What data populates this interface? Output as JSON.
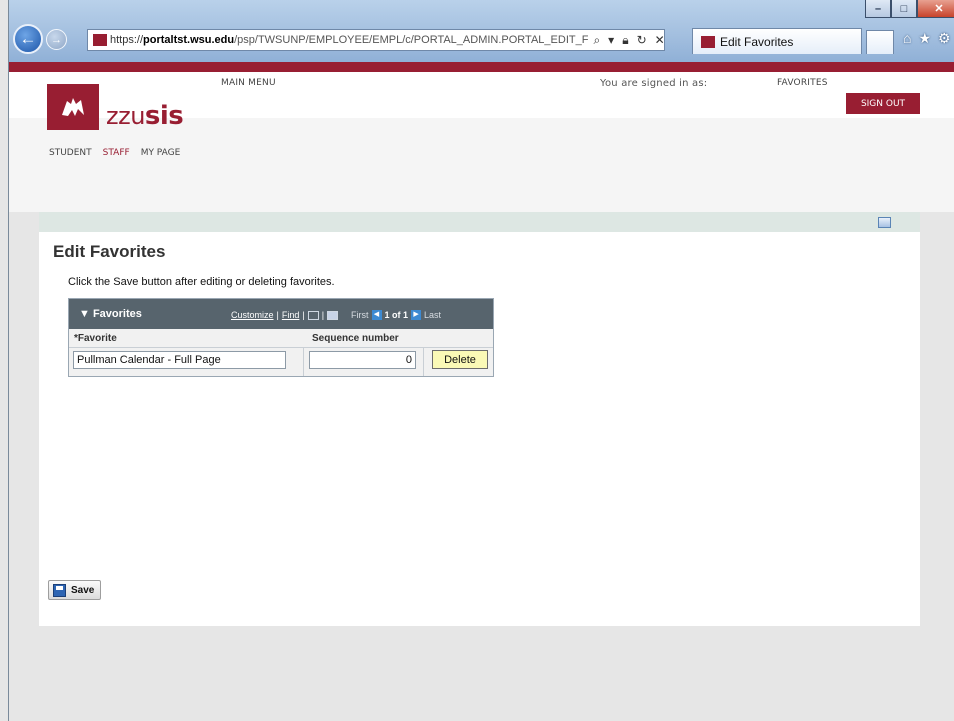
{
  "browser": {
    "url_scheme": "https://",
    "url_domain": "portaltst.wsu.edu",
    "url_path": "/psp/TWSUNP/EMPLOYEE/EMPL/c/PORTAL_ADMIN.PORTAL_EDIT_F",
    "tab_title": "Edit Favorites"
  },
  "header": {
    "main_menu": "MAIN MENU",
    "signed_in": "You are signed in as:",
    "favorites": "FAVORITES",
    "sign_out": "SIGN OUT",
    "logo_light": "zzu",
    "logo_bold": "sis",
    "nav": [
      "STUDENT",
      "STAFF",
      "MY PAGE"
    ],
    "active_nav": "STAFF"
  },
  "content": {
    "title": "Edit Favorites",
    "instruction": "Click the Save button after editing or deleting favorites.",
    "grid": {
      "title": "Favorites",
      "customize": "Customize",
      "find": "Find",
      "pager_first": "First",
      "pager_range": "1 of 1",
      "pager_last": "Last",
      "col_favorite": "*Favorite",
      "col_sequence": "Sequence number",
      "rows": [
        {
          "favorite": "Pullman Calendar - Full Page",
          "sequence": "0",
          "delete_label": "Delete"
        }
      ]
    },
    "save_label": "Save"
  },
  "colors": {
    "brand": "#981e32",
    "grid_header": "#57646d",
    "delete_button": "#faf9b6"
  }
}
